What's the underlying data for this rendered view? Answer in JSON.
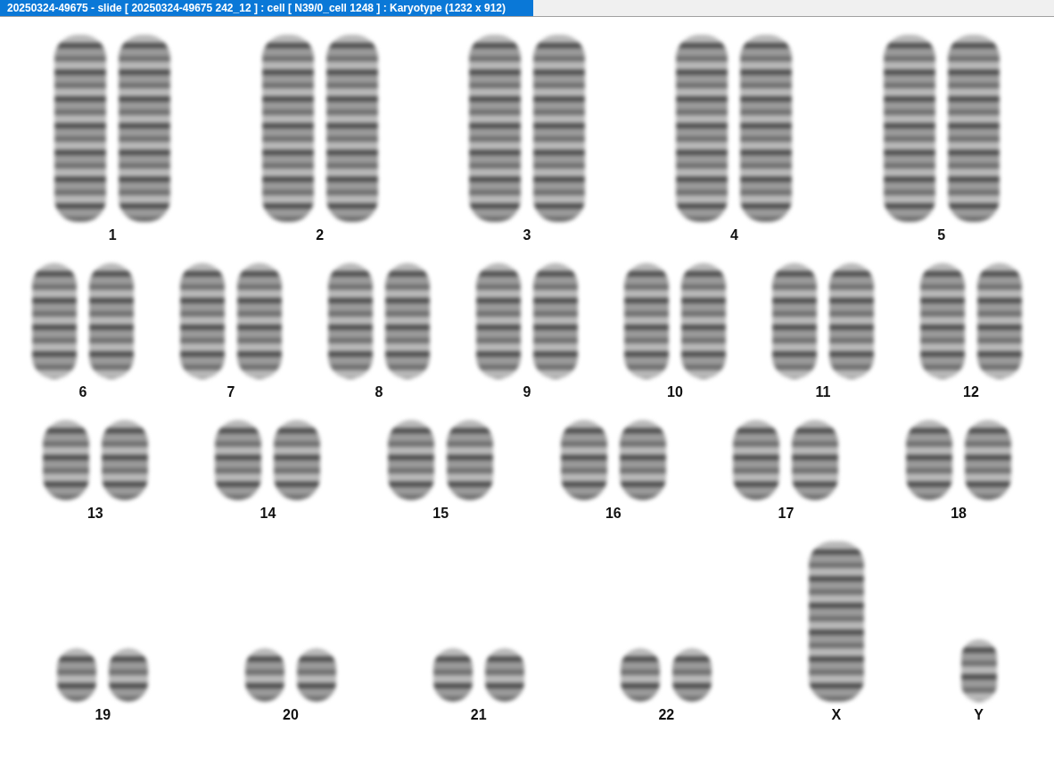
{
  "window": {
    "title": "20250324-49675 - slide [ 20250324-49675 242_12 ] : cell [ N39/0_cell 1248 ] : Karyotype  (1232 x 912)"
  },
  "rows": [
    {
      "groups": [
        {
          "label": "1",
          "kind": "pair"
        },
        {
          "label": "2",
          "kind": "pair"
        },
        {
          "label": "3",
          "kind": "pair"
        },
        {
          "label": "4",
          "kind": "pair"
        },
        {
          "label": "5",
          "kind": "pair"
        }
      ]
    },
    {
      "groups": [
        {
          "label": "6",
          "kind": "pair"
        },
        {
          "label": "7",
          "kind": "pair"
        },
        {
          "label": "8",
          "kind": "pair"
        },
        {
          "label": "9",
          "kind": "pair"
        },
        {
          "label": "10",
          "kind": "pair"
        },
        {
          "label": "11",
          "kind": "pair"
        },
        {
          "label": "12",
          "kind": "pair"
        }
      ]
    },
    {
      "groups": [
        {
          "label": "13",
          "kind": "pair"
        },
        {
          "label": "14",
          "kind": "pair"
        },
        {
          "label": "15",
          "kind": "pair"
        },
        {
          "label": "16",
          "kind": "pair"
        },
        {
          "label": "17",
          "kind": "pair"
        },
        {
          "label": "18",
          "kind": "pair"
        }
      ]
    },
    {
      "groups": [
        {
          "label": "19",
          "kind": "pair"
        },
        {
          "label": "20",
          "kind": "pair"
        },
        {
          "label": "21",
          "kind": "pair"
        },
        {
          "label": "22",
          "kind": "pair"
        },
        {
          "label": "X",
          "kind": "single"
        },
        {
          "label": "Y",
          "kind": "single"
        }
      ]
    }
  ]
}
